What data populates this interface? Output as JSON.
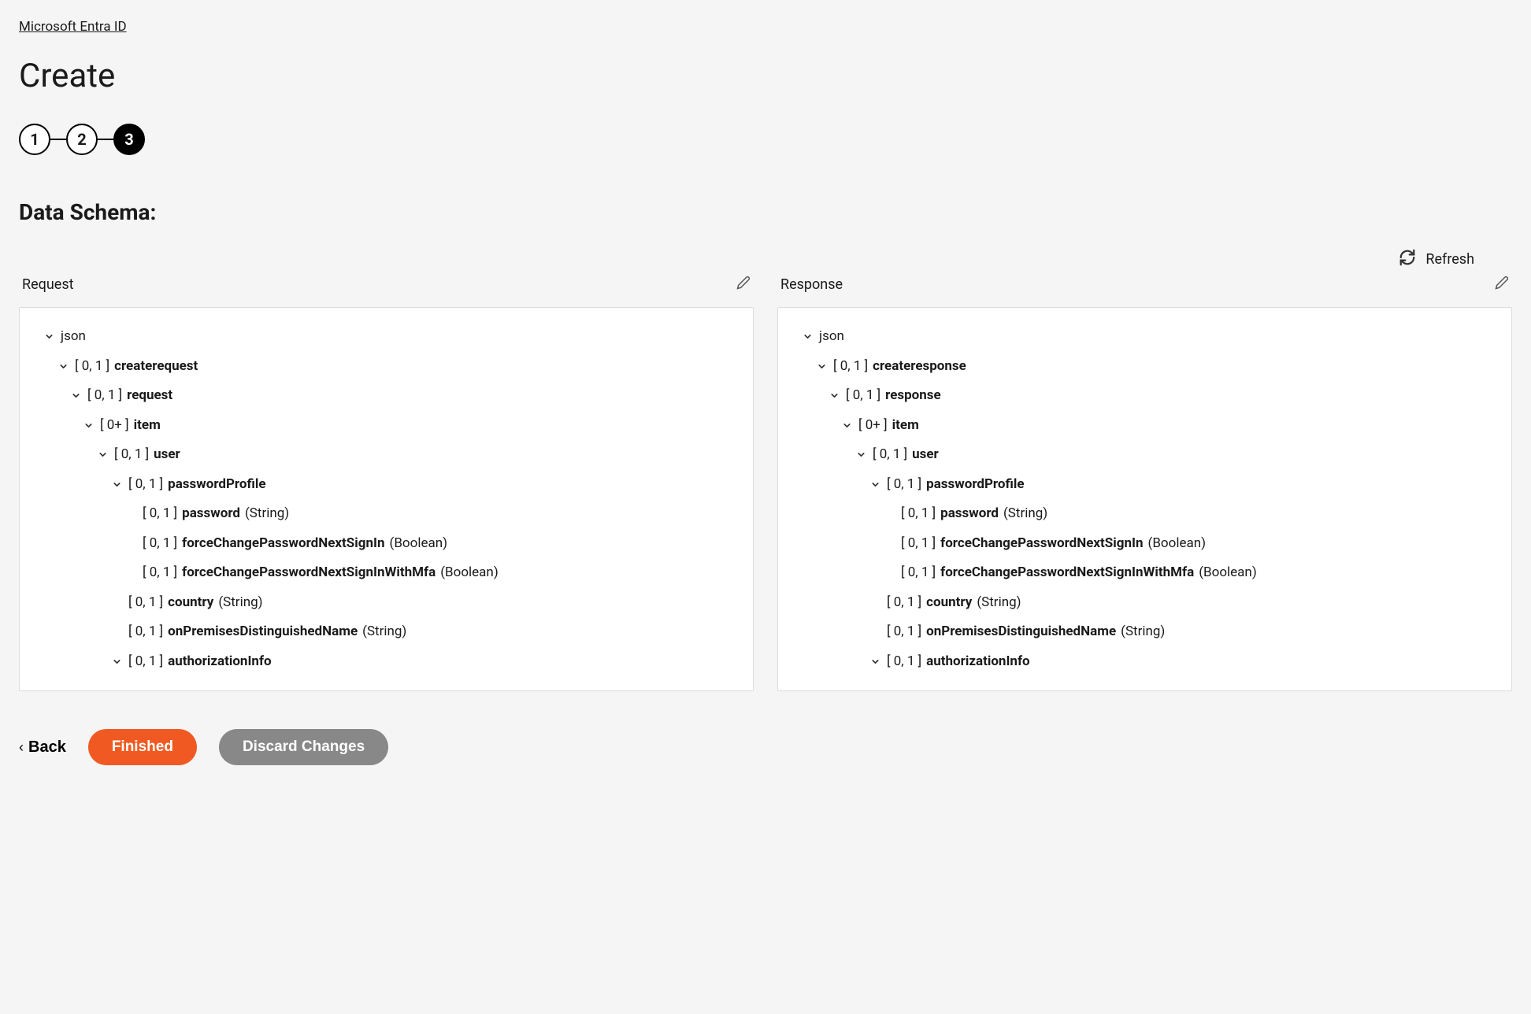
{
  "breadcrumb": "Microsoft Entra ID",
  "title": "Create",
  "stepper": {
    "steps": [
      "1",
      "2",
      "3"
    ],
    "active_index": 2
  },
  "section_title": "Data Schema:",
  "refresh_label": "Refresh",
  "panels": {
    "request": {
      "title": "Request",
      "rows": [
        {
          "indent": 0,
          "chevron": true,
          "cardinality": "",
          "name": "json",
          "type": "",
          "bold": false
        },
        {
          "indent": 1,
          "chevron": true,
          "cardinality": "[ 0, 1 ]",
          "name": "createrequest",
          "type": ""
        },
        {
          "indent": 2,
          "chevron": true,
          "cardinality": "[ 0, 1 ]",
          "name": "request",
          "type": ""
        },
        {
          "indent": 3,
          "chevron": true,
          "cardinality": "[ 0+ ]",
          "name": "item",
          "type": ""
        },
        {
          "indent": 4,
          "chevron": true,
          "cardinality": "[ 0, 1 ]",
          "name": "user",
          "type": ""
        },
        {
          "indent": 5,
          "chevron": true,
          "cardinality": "[ 0, 1 ]",
          "name": "passwordProfile",
          "type": ""
        },
        {
          "indent": 6,
          "chevron": false,
          "cardinality": "[ 0, 1 ]",
          "name": "password",
          "type": "(String)"
        },
        {
          "indent": 6,
          "chevron": false,
          "cardinality": "[ 0, 1 ]",
          "name": "forceChangePasswordNextSignIn",
          "type": "(Boolean)"
        },
        {
          "indent": 6,
          "chevron": false,
          "cardinality": "[ 0, 1 ]",
          "name": "forceChangePasswordNextSignInWithMfa",
          "type": "(Boolean)"
        },
        {
          "indent": 5,
          "chevron": false,
          "cardinality": "[ 0, 1 ]",
          "name": "country",
          "type": "(String)"
        },
        {
          "indent": 5,
          "chevron": false,
          "cardinality": "[ 0, 1 ]",
          "name": "onPremisesDistinguishedName",
          "type": "(String)"
        },
        {
          "indent": 5,
          "chevron": true,
          "cardinality": "[ 0, 1 ]",
          "name": "authorizationInfo",
          "type": ""
        }
      ]
    },
    "response": {
      "title": "Response",
      "rows": [
        {
          "indent": 0,
          "chevron": true,
          "cardinality": "",
          "name": "json",
          "type": "",
          "bold": false
        },
        {
          "indent": 1,
          "chevron": true,
          "cardinality": "[ 0, 1 ]",
          "name": "createresponse",
          "type": ""
        },
        {
          "indent": 2,
          "chevron": true,
          "cardinality": "[ 0, 1 ]",
          "name": "response",
          "type": ""
        },
        {
          "indent": 3,
          "chevron": true,
          "cardinality": "[ 0+ ]",
          "name": "item",
          "type": ""
        },
        {
          "indent": 4,
          "chevron": true,
          "cardinality": "[ 0, 1 ]",
          "name": "user",
          "type": ""
        },
        {
          "indent": 5,
          "chevron": true,
          "cardinality": "[ 0, 1 ]",
          "name": "passwordProfile",
          "type": ""
        },
        {
          "indent": 6,
          "chevron": false,
          "cardinality": "[ 0, 1 ]",
          "name": "password",
          "type": "(String)"
        },
        {
          "indent": 6,
          "chevron": false,
          "cardinality": "[ 0, 1 ]",
          "name": "forceChangePasswordNextSignIn",
          "type": "(Boolean)"
        },
        {
          "indent": 6,
          "chevron": false,
          "cardinality": "[ 0, 1 ]",
          "name": "forceChangePasswordNextSignInWithMfa",
          "type": "(Boolean)"
        },
        {
          "indent": 5,
          "chevron": false,
          "cardinality": "[ 0, 1 ]",
          "name": "country",
          "type": "(String)"
        },
        {
          "indent": 5,
          "chevron": false,
          "cardinality": "[ 0, 1 ]",
          "name": "onPremisesDistinguishedName",
          "type": "(String)"
        },
        {
          "indent": 5,
          "chevron": true,
          "cardinality": "[ 0, 1 ]",
          "name": "authorizationInfo",
          "type": ""
        }
      ]
    }
  },
  "buttons": {
    "back": "Back",
    "finished": "Finished",
    "discard": "Discard Changes"
  }
}
